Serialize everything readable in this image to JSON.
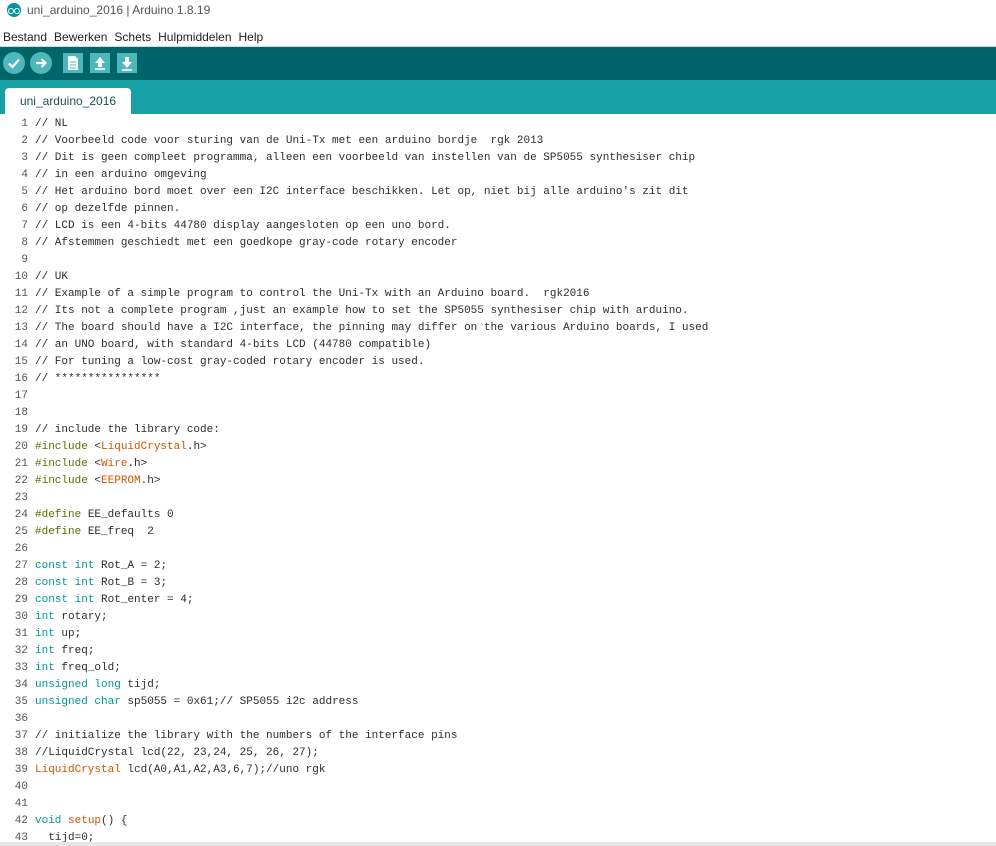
{
  "window": {
    "title": "uni_arduino_2016 | Arduino 1.8.19"
  },
  "menu": [
    "Bestand",
    "Bewerken",
    "Schets",
    "Hulpmiddelen",
    "Help"
  ],
  "toolbar": {
    "buttons": [
      {
        "name": "verify",
        "icon": "checkmark-icon"
      },
      {
        "name": "upload",
        "icon": "arrow-right-icon"
      },
      {
        "name": "new",
        "icon": "new-file-icon"
      },
      {
        "name": "open",
        "icon": "arrow-up-icon"
      },
      {
        "name": "save",
        "icon": "arrow-down-icon"
      }
    ]
  },
  "tab": {
    "label": "uni_arduino_2016"
  },
  "colors": {
    "toolbar": "#006468",
    "tabbar": "#17a1a5",
    "keyword": "#00979d",
    "preprocessor": "#5e6d03",
    "library": "#d35400"
  },
  "code": {
    "lines": [
      {
        "n": "1",
        "t": "// NL"
      },
      {
        "n": "2",
        "t": "// Voorbeeld code voor sturing van de Uni-Tx met een arduino bordje  rgk 2013"
      },
      {
        "n": "3",
        "t": "// Dit is geen compleet programma, alleen een voorbeeld van instellen van de SP5055 synthesiser chip"
      },
      {
        "n": "4",
        "t": "// in een arduino omgeving"
      },
      {
        "n": "5",
        "t": "// Het arduino bord moet over een I2C interface beschikken. Let op, niet bij alle arduino's zit dit"
      },
      {
        "n": "6",
        "t": "// op dezelfde pinnen."
      },
      {
        "n": "7",
        "t": "// LCD is een 4-bits 44780 display aangesloten op een uno bord."
      },
      {
        "n": "8",
        "t": "// Afstemmen geschiedt met een goedkope gray-code rotary encoder"
      },
      {
        "n": "9",
        "t": ""
      },
      {
        "n": "10",
        "t": "// UK"
      },
      {
        "n": "11",
        "t": "// Example of a simple program to control the Uni-Tx with an Arduino board.  rgk2016"
      },
      {
        "n": "12",
        "t": "// Its not a complete program ,just an example how to set the SP5055 synthesiser chip with arduino."
      },
      {
        "n": "13",
        "t": "// The board should have a I2C interface, the pinning may differ on the various Arduino boards, I used"
      },
      {
        "n": "14",
        "t": "// an UNO board, with standard 4-bits LCD (44780 compatible)"
      },
      {
        "n": "15",
        "t": "// For tuning a low-cost gray-coded rotary encoder is used."
      },
      {
        "n": "16",
        "t": "// ****************"
      },
      {
        "n": "17",
        "t": ""
      },
      {
        "n": "18",
        "t": ""
      },
      {
        "n": "19",
        "t": "// include the library code:"
      },
      {
        "n": "20",
        "t": "#include <LiquidCrystal.h>"
      },
      {
        "n": "21",
        "t": "#include <Wire.h>"
      },
      {
        "n": "22",
        "t": "#include <EEPROM.h>"
      },
      {
        "n": "23",
        "t": ""
      },
      {
        "n": "24",
        "t": "#define EE_defaults 0"
      },
      {
        "n": "25",
        "t": "#define EE_freq  2"
      },
      {
        "n": "26",
        "t": ""
      },
      {
        "n": "27",
        "t": "const int Rot_A = 2;"
      },
      {
        "n": "28",
        "t": "const int Rot_B = 3;"
      },
      {
        "n": "29",
        "t": "const int Rot_enter = 4;"
      },
      {
        "n": "30",
        "t": "int rotary;"
      },
      {
        "n": "31",
        "t": "int up;"
      },
      {
        "n": "32",
        "t": "int freq;"
      },
      {
        "n": "33",
        "t": "int freq_old;"
      },
      {
        "n": "34",
        "t": "unsigned long tijd;"
      },
      {
        "n": "35",
        "t": "unsigned char sp5055 = 0x61;// SP5055 i2c address"
      },
      {
        "n": "36",
        "t": ""
      },
      {
        "n": "37",
        "t": "// initialize the library with the numbers of the interface pins"
      },
      {
        "n": "38",
        "t": "//LiquidCrystal lcd(22, 23,24, 25, 26, 27);"
      },
      {
        "n": "39",
        "t": "LiquidCrystal lcd(A0,A1,A2,A3,6,7);//uno rgk"
      },
      {
        "n": "40",
        "t": ""
      },
      {
        "n": "41",
        "t": ""
      },
      {
        "n": "42",
        "t": "void setup() {"
      },
      {
        "n": "43",
        "t": "  tijd=0;"
      }
    ]
  }
}
